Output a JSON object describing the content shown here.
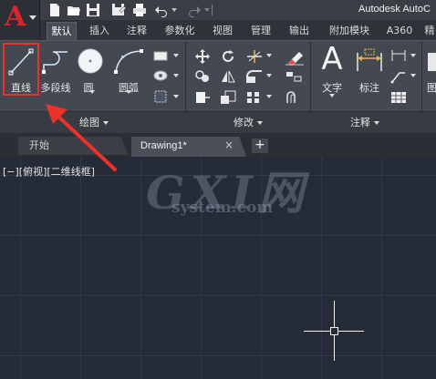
{
  "app": {
    "title": "Autodesk AutoC",
    "logo_letter": "A",
    "brand_color": "#d7262b"
  },
  "quick_access": [
    "new-file-icon",
    "open-folder-icon",
    "save-icon",
    "save-as-icon",
    "print-icon",
    "undo-icon",
    "redo-icon"
  ],
  "ribbon": {
    "tabs": [
      "默认",
      "插入",
      "注释",
      "参数化",
      "视图",
      "管理",
      "输出",
      "附加模块",
      "A360",
      "精"
    ],
    "active_tab": "默认",
    "panels": [
      {
        "label": "绘图",
        "buttons": [
          "直线",
          "多段线",
          "圆",
          "圆弧"
        ]
      },
      {
        "label": "修改"
      },
      {
        "label": "注释",
        "buttons": [
          "文字",
          "标注"
        ]
      }
    ],
    "partial_button_label": "图"
  },
  "document_tabs": {
    "start": "开始",
    "drawing": "Drawing1*",
    "close_symbol": "×",
    "add_symbol": "+"
  },
  "viewport_label": "[−][俯视][二维线框]",
  "watermark": {
    "main": "GXI网",
    "sub": "system.com"
  },
  "highlight_color": "#e8322a"
}
